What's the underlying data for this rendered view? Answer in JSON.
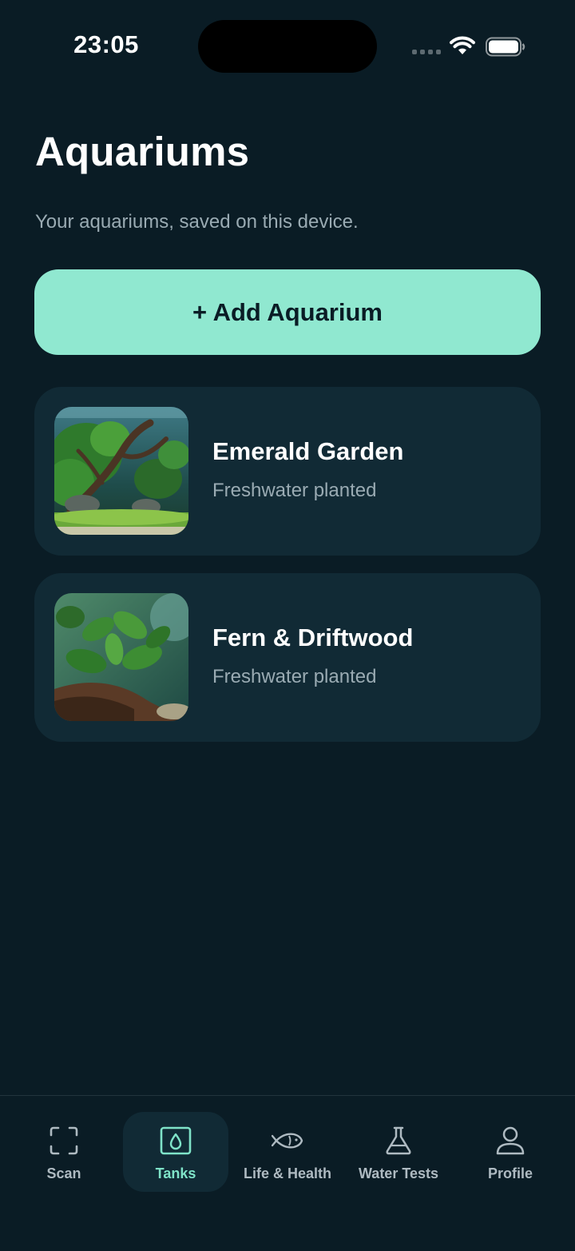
{
  "status_bar": {
    "time": "23:05"
  },
  "header": {
    "title": "Aquariums",
    "subtitle": "Your aquariums, saved on this device."
  },
  "add_button": {
    "label": "+ Add Aquarium"
  },
  "tanks": [
    {
      "name": "Emerald Garden",
      "type": "Freshwater planted"
    },
    {
      "name": "Fern & Driftwood",
      "type": "Freshwater planted"
    }
  ],
  "tab_bar": {
    "tabs": [
      {
        "label": "Scan",
        "icon": "scan-icon"
      },
      {
        "label": "Tanks",
        "icon": "water-drop-icon",
        "active": true
      },
      {
        "label": "Life & Health",
        "icon": "fish-icon"
      },
      {
        "label": "Water Tests",
        "icon": "flask-icon"
      },
      {
        "label": "Profile",
        "icon": "person-icon"
      }
    ]
  },
  "colors": {
    "background": "#0a1c25",
    "card": "#112a35",
    "accent": "#90e8d0",
    "active_tab_label": "#7fe3c8",
    "secondary_text": "#9aabb3"
  }
}
